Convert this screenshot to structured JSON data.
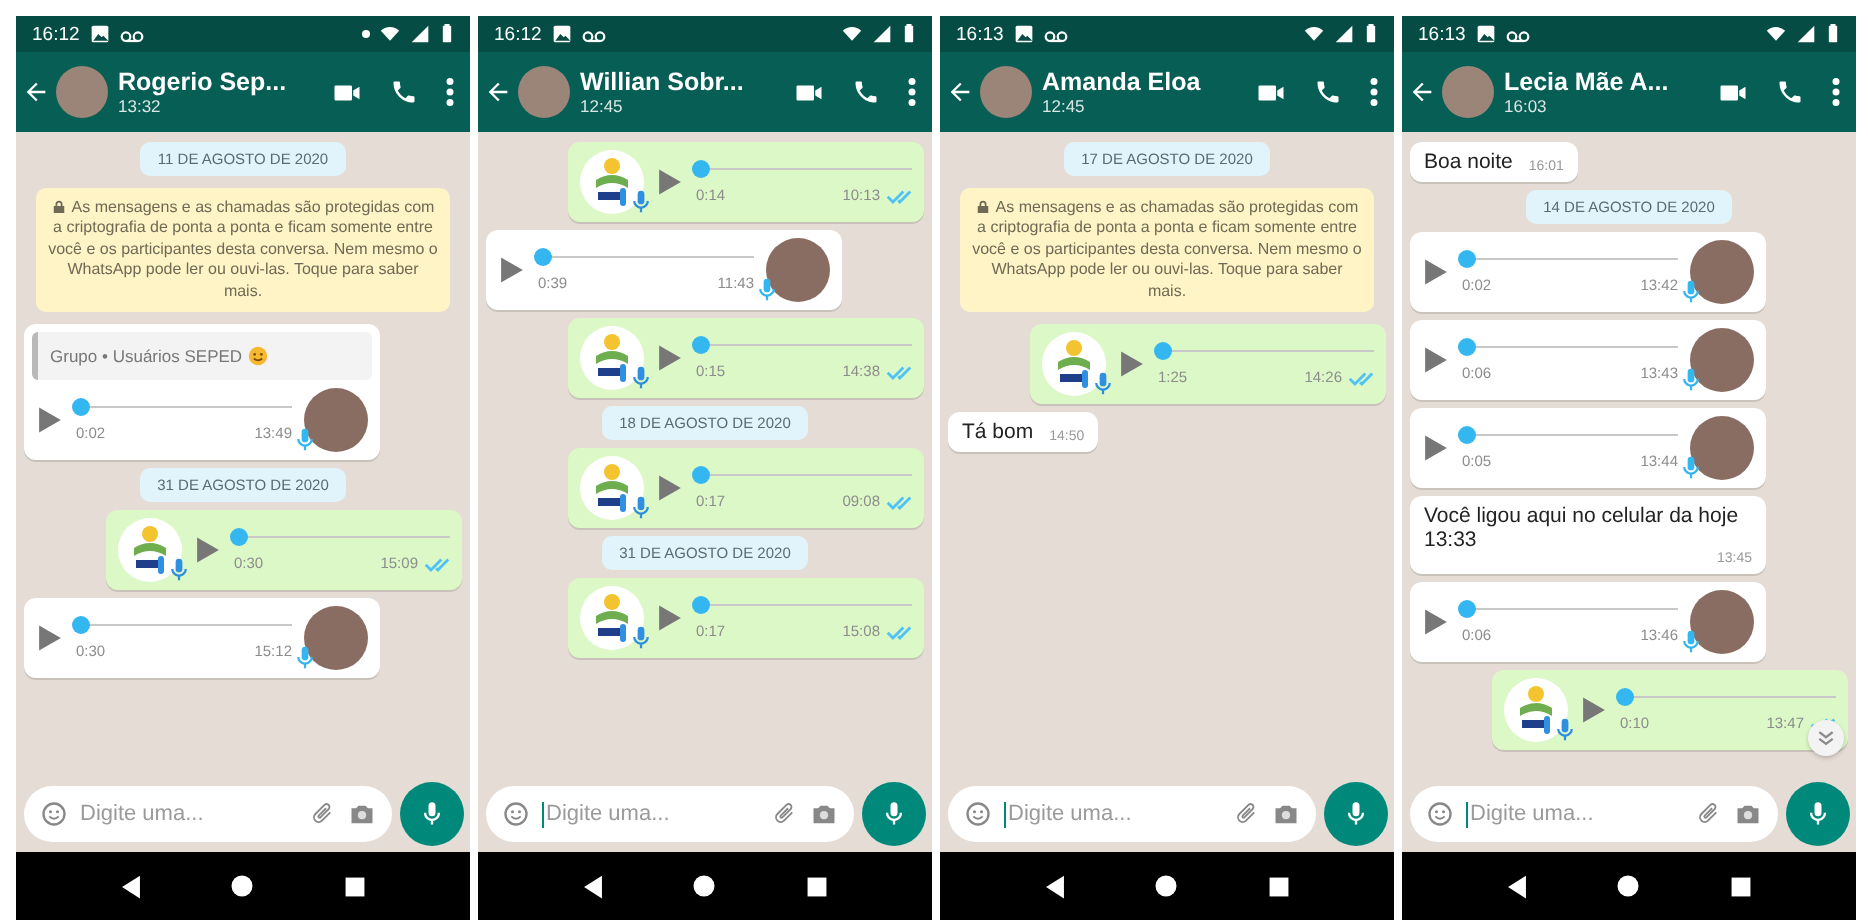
{
  "phones": [
    {
      "status_time": "16:12",
      "status_dot": true,
      "contact": {
        "name": "Rogerio Sep...",
        "subtitle": "13:32"
      },
      "messages": [
        {
          "kind": "date",
          "text": "11 DE AGOSTO DE 2020"
        },
        {
          "kind": "system",
          "text": "As mensagens e as chamadas são protegidas com a criptografia de ponta a ponta e ficam somente entre você e os participantes desta conversa. Nem mesmo o WhatsApp pode ler ou ouvi-las. Toque para saber mais."
        },
        {
          "kind": "voice",
          "outgoing": false,
          "quote": "Grupo • Usuários SEPED",
          "quote_smiley": true,
          "duration": "0:02",
          "time": "13:49",
          "level": 0
        },
        {
          "kind": "date",
          "text": "31 DE AGOSTO DE 2020"
        },
        {
          "kind": "voice",
          "outgoing": true,
          "duration": "0:30",
          "time": "15:09",
          "level": 0,
          "read": true
        },
        {
          "kind": "voice",
          "outgoing": false,
          "duration": "0:30",
          "time": "15:12",
          "level": 0
        }
      ],
      "input": {
        "placeholder": "Digite uma...",
        "focused": false
      },
      "scroll_button": false
    },
    {
      "status_time": "16:12",
      "status_dot": false,
      "contact": {
        "name": "Willian Sobr...",
        "subtitle": "12:45"
      },
      "messages": [
        {
          "kind": "voice",
          "outgoing": true,
          "duration": "0:14",
          "time": "10:13",
          "level": 0,
          "read": true
        },
        {
          "kind": "voice",
          "outgoing": false,
          "duration": "0:39",
          "time": "11:43",
          "level": 0
        },
        {
          "kind": "voice",
          "outgoing": true,
          "duration": "0:15",
          "time": "14:38",
          "level": 0,
          "read": true
        },
        {
          "kind": "date",
          "text": "18 DE AGOSTO DE 2020"
        },
        {
          "kind": "voice",
          "outgoing": true,
          "duration": "0:17",
          "time": "09:08",
          "level": 0,
          "read": true
        },
        {
          "kind": "date",
          "text": "31 DE AGOSTO DE 2020"
        },
        {
          "kind": "voice",
          "outgoing": true,
          "duration": "0:17",
          "time": "15:08",
          "level": 0,
          "read": true
        }
      ],
      "input": {
        "placeholder": "Digite uma...",
        "focused": true
      },
      "scroll_button": false
    },
    {
      "status_time": "16:13",
      "status_dot": false,
      "contact": {
        "name": "Amanda Eloa",
        "subtitle": "12:45"
      },
      "messages": [
        {
          "kind": "date",
          "text": "17 DE AGOSTO DE 2020"
        },
        {
          "kind": "system",
          "text": "As mensagens e as chamadas são protegidas com a criptografia de ponta a ponta e ficam somente entre você e os participantes desta conversa. Nem mesmo o WhatsApp pode ler ou ouvi-las. Toque para saber mais."
        },
        {
          "kind": "voice",
          "outgoing": true,
          "duration": "1:25",
          "time": "14:26",
          "level": 0,
          "read": true
        },
        {
          "kind": "text",
          "outgoing": false,
          "text": "Tá bom",
          "time": "14:50"
        }
      ],
      "input": {
        "placeholder": "Digite uma...",
        "focused": true
      },
      "scroll_button": false
    },
    {
      "status_time": "16:13",
      "status_dot": false,
      "contact": {
        "name": "Lecia Mãe A...",
        "subtitle": "16:03"
      },
      "messages": [
        {
          "kind": "text",
          "outgoing": false,
          "text": "Boa noite",
          "time": "16:01"
        },
        {
          "kind": "date",
          "text": "14 DE AGOSTO DE 2020"
        },
        {
          "kind": "voice",
          "outgoing": false,
          "duration": "0:02",
          "time": "13:42",
          "level": 0
        },
        {
          "kind": "voice",
          "outgoing": false,
          "duration": "0:06",
          "time": "13:43",
          "level": 0
        },
        {
          "kind": "voice",
          "outgoing": false,
          "duration": "0:05",
          "time": "13:44",
          "level": 0
        },
        {
          "kind": "text",
          "outgoing": false,
          "text": "Você ligou aqui no celular da hoje 13:33",
          "time": "13:45"
        },
        {
          "kind": "voice",
          "outgoing": false,
          "duration": "0:06",
          "time": "13:46",
          "level": 0
        },
        {
          "kind": "voice",
          "outgoing": true,
          "duration": "0:10",
          "time": "13:47",
          "level": 0,
          "read": true
        }
      ],
      "input": {
        "placeholder": "Digite uma...",
        "focused": true
      },
      "scroll_button": true
    }
  ]
}
